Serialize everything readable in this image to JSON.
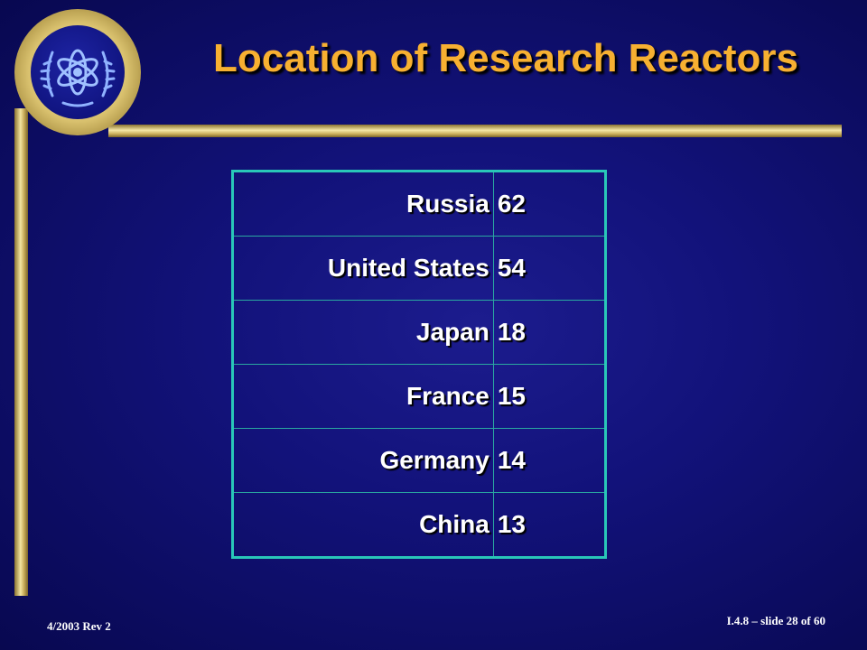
{
  "slide": {
    "title": "Location of Research Reactors",
    "footer_left": "4/2003 Rev 2",
    "footer_right": "I.4.8 – slide 28 of 60"
  },
  "table": {
    "rows": [
      {
        "country": "Russia",
        "count": "62"
      },
      {
        "country": "United States",
        "count": "54"
      },
      {
        "country": "Japan",
        "count": "18"
      },
      {
        "country": "France",
        "count": "15"
      },
      {
        "country": "Germany",
        "count": "14"
      },
      {
        "country": "China",
        "count": "13"
      }
    ]
  },
  "colors": {
    "title": "#f7b031",
    "table_border": "#29c7b8",
    "accent_gold": "#d9c16e"
  },
  "icons": {
    "logo": "iaea-atom-emblem"
  }
}
